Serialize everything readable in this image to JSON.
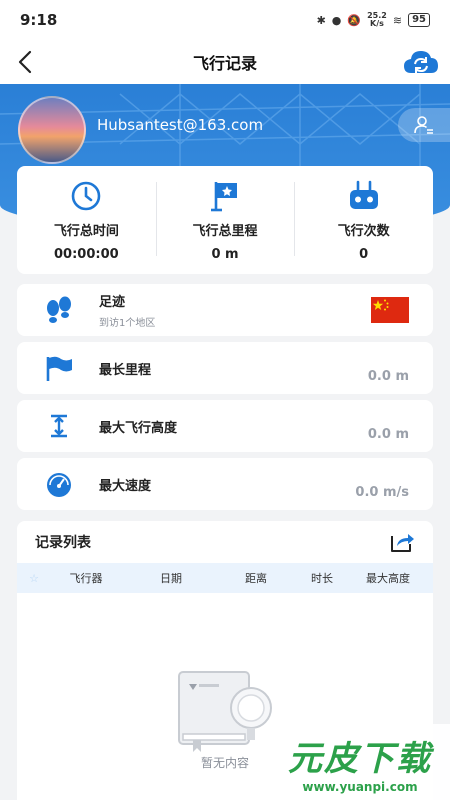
{
  "status_bar": {
    "time": "9:18",
    "net_speed_value": "25.2",
    "net_speed_unit": "K/s",
    "battery": "95"
  },
  "nav": {
    "title": "飞行记录",
    "icons": {
      "back": "chevron-left-icon",
      "cloud": "cloud-sync-icon"
    }
  },
  "profile": {
    "email": "Hubsantest@163.com",
    "button_icon": "user-settings-icon"
  },
  "stats": [
    {
      "label": "飞行总时间",
      "value": "00:00:00",
      "icon": "clock-icon"
    },
    {
      "label": "飞行总里程",
      "value": "0 m",
      "icon": "flag-icon"
    },
    {
      "label": "飞行次数",
      "value": "0",
      "icon": "controller-icon"
    }
  ],
  "rows": {
    "footprint": {
      "title": "足迹",
      "subtitle": "到访1个地区",
      "icon": "footprint-icon",
      "flag": "china-flag"
    },
    "longest": {
      "title": "最长里程",
      "value": "0.0 m",
      "icon": "flag-icon"
    },
    "altitude": {
      "title": "最大飞行高度",
      "value": "0.0 m",
      "icon": "altitude-icon"
    },
    "speed": {
      "title": "最大速度",
      "value": "0.0 m/s",
      "icon": "speedometer-icon"
    }
  },
  "records": {
    "title": "记录列表",
    "columns": [
      "飞行器",
      "日期",
      "距离",
      "时长",
      "最大高度"
    ],
    "empty_text": "暂无内容"
  },
  "watermark": {
    "main": "元皮下载",
    "url": "www.yuanpi.com"
  },
  "colors": {
    "accent": "#1e78d6",
    "hero": "#2a7fd6",
    "header_bg": "#eaf3fd",
    "china_red": "#de2910"
  }
}
